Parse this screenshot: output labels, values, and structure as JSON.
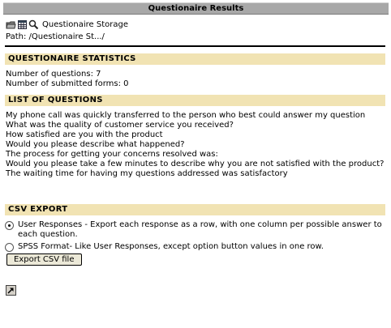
{
  "window": {
    "title": "Questionaire Results"
  },
  "toolbar": {
    "storage_label": "Questionaire Storage",
    "icons": [
      "folder-icon",
      "table-icon",
      "search-icon"
    ]
  },
  "path": {
    "text": "Path: /Questionaire St.../"
  },
  "statistics": {
    "header": "QUESTIONAIRE STATISTICS",
    "num_questions": "Number of questions: 7",
    "num_forms": "Number of submitted forms: 0"
  },
  "questions": {
    "header": "LIST OF QUESTIONS",
    "items": [
      "My phone call was quickly transferred to the person who best could answer my question",
      "What was the quality of customer service you received?",
      "How satisfied are you with the product",
      "Would you please describe what happened?",
      "The process for getting your concerns resolved was:",
      "Would you please take a few minutes to describe why you are not satisfied with the product?",
      "The waiting time for having my questions addressed was satisfactory"
    ]
  },
  "csv": {
    "header": "CSV EXPORT",
    "options": [
      {
        "label": "User Responses - Export each response as a row, with one column per possible answer to each question.",
        "checked": true
      },
      {
        "label": "SPSS Format- Like User Responses, except option button values in one row.",
        "checked": false
      }
    ],
    "export_button": "Export CSV file"
  }
}
